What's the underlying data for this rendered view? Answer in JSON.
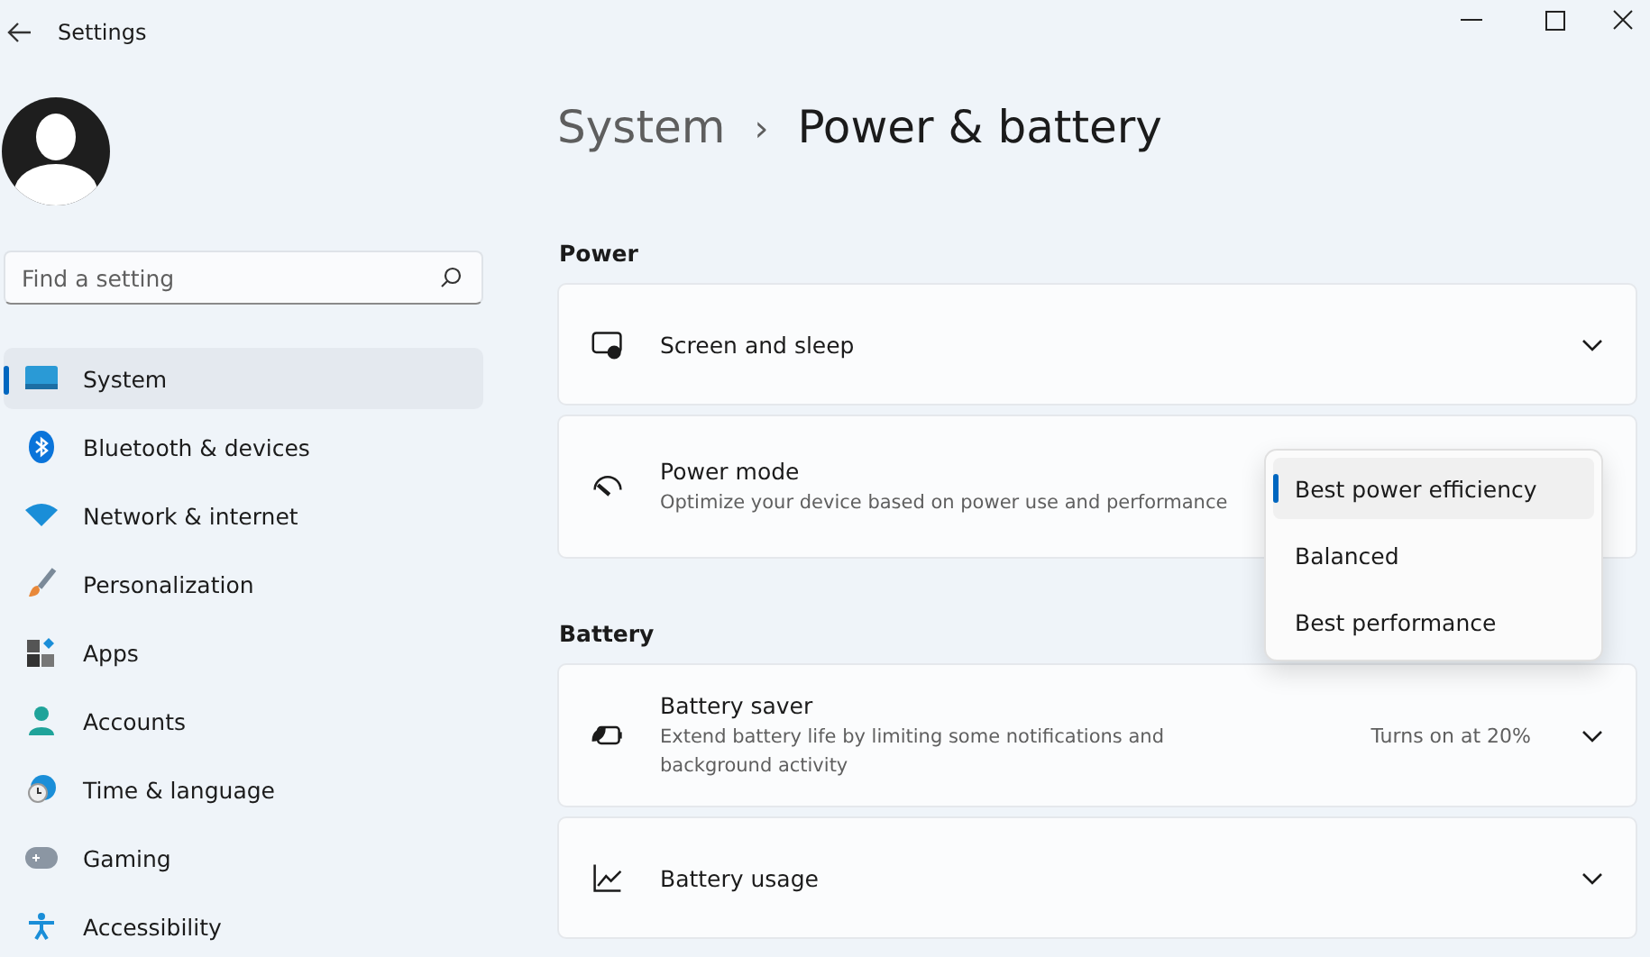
{
  "window": {
    "title": "Settings"
  },
  "search": {
    "placeholder": "Find a setting"
  },
  "nav": [
    {
      "label": "System",
      "kind": "system",
      "selected": true
    },
    {
      "label": "Bluetooth & devices",
      "kind": "bluetooth",
      "selected": false
    },
    {
      "label": "Network & internet",
      "kind": "wifi",
      "selected": false
    },
    {
      "label": "Personalization",
      "kind": "brush",
      "selected": false
    },
    {
      "label": "Apps",
      "kind": "apps",
      "selected": false
    },
    {
      "label": "Accounts",
      "kind": "person",
      "selected": false
    },
    {
      "label": "Time & language",
      "kind": "globe",
      "selected": false
    },
    {
      "label": "Gaming",
      "kind": "gamepad",
      "selected": false
    },
    {
      "label": "Accessibility",
      "kind": "accessibility",
      "selected": false
    }
  ],
  "breadcrumb": {
    "parent": "System",
    "separator": "›",
    "current": "Power & battery"
  },
  "sections": [
    {
      "title": "Power",
      "cards": [
        {
          "kind": "screen",
          "title": "Screen and sleep",
          "expandable": true
        },
        {
          "kind": "gauge",
          "title": "Power mode",
          "description": "Optimize your device based on power use and performance",
          "dropdown": [
            {
              "label": "Best power efficiency",
              "selected": true
            },
            {
              "label": "Balanced",
              "selected": false
            },
            {
              "label": "Best performance",
              "selected": false
            }
          ]
        }
      ]
    },
    {
      "title": "Battery",
      "cards": [
        {
          "kind": "battery",
          "title": "Battery saver",
          "description": "Extend battery life by limiting some notifications and background activity",
          "value": "Turns on at 20%",
          "expandable": true
        },
        {
          "kind": "chart",
          "title": "Battery usage",
          "expandable": true
        }
      ]
    }
  ]
}
